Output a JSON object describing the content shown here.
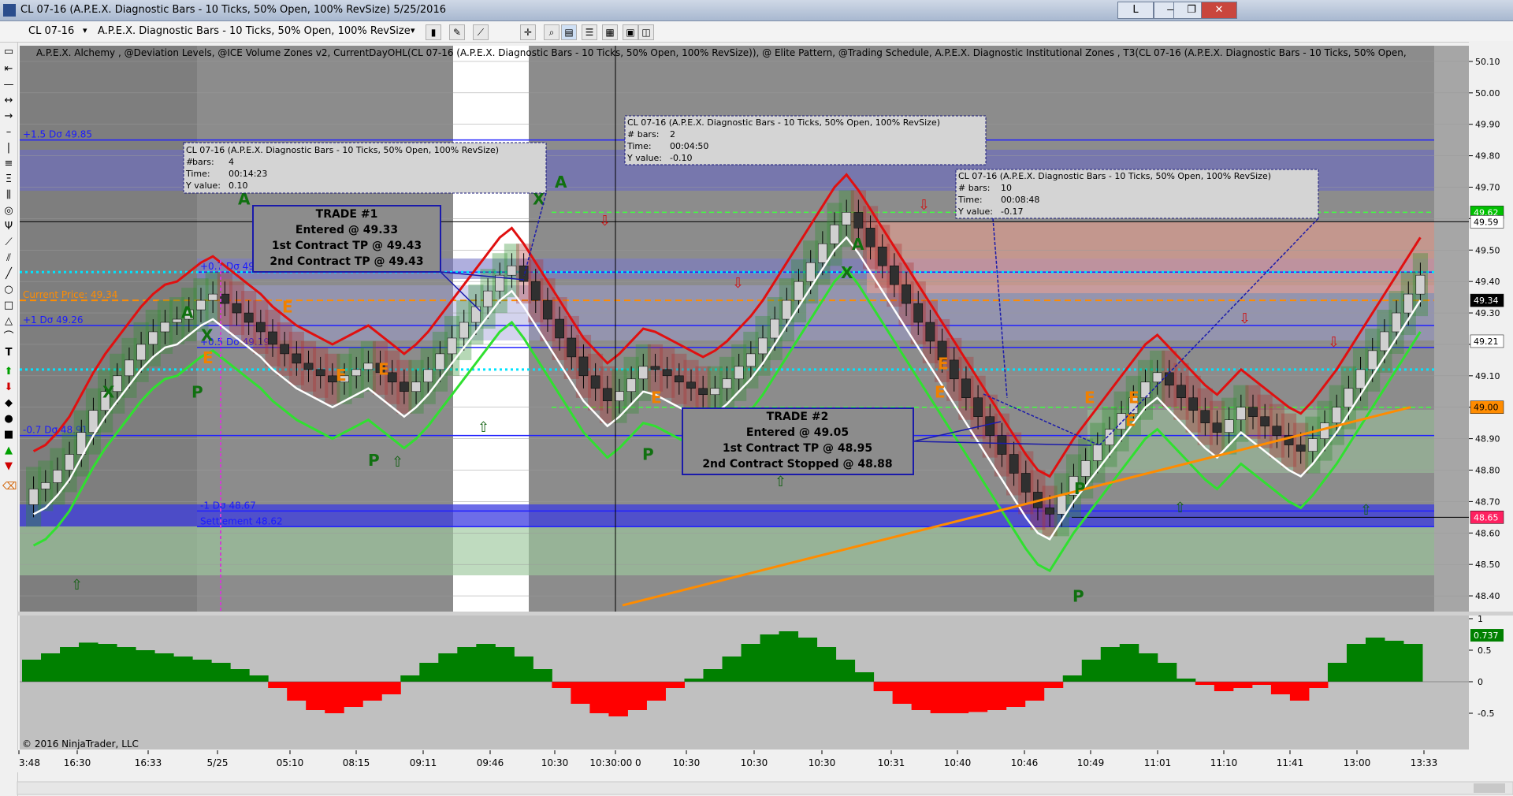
{
  "window": {
    "title": "CL 07-16 (A.P.E.X. Diagnostic Bars - 10 Ticks, 50% Open, 100% RevSize)  5/25/2016",
    "buttons": [
      "L",
      "—",
      "❐",
      "✕"
    ]
  },
  "toolbar": {
    "instrument": "CL 07-16",
    "bar_type": "A.P.E.X. Diagnostic Bars - 10 Ticks, 50% Open, 100% RevSize"
  },
  "indicator_label": "A.P.E.X. Alchemy , @Deviation Levels, @ICE Volume Zones v2, CurrentDayOHL(CL 07-16 (A.P.E.X. Diagnostic Bars - 10 Ticks, 50% Open, 100% RevSize)), @ Elite Pattern, @Trading Schedule, A.P.E.X. Diagnostic Institutional Zones , T3(CL 07-16 (A.P.E.X. Diagnostic Bars - 10 Ticks, 50% Open,",
  "copyright": "© 2016 NinjaTrader, LLC",
  "colors": {
    "up_bar": "#00c000",
    "down_bar": "#d00000",
    "pos_hist": "#008000",
    "neg_hist": "#ff0000",
    "price_line": "#ff8c00",
    "zone_blue": "#3a3aff",
    "cyan_level": "#00e5ff"
  },
  "chart_data": {
    "type": "candlestick",
    "instrument": "CL 07-16",
    "date": "5/25/2016",
    "ylim": [
      48.35,
      50.15
    ],
    "y_ticks": [
      "50.10",
      "50.00",
      "49.90",
      "49.80",
      "49.70",
      "49.60",
      "49.50",
      "49.40",
      "49.30",
      "49.20",
      "49.10",
      "49.00",
      "48.90",
      "48.80",
      "48.70",
      "48.60",
      "48.50",
      "48.40"
    ],
    "x_ticks": [
      "3:48",
      "16:30",
      "16:33",
      "5/25",
      "05:10",
      "08:15",
      "09:11",
      "09:46",
      "10:30",
      "10:30:00 0",
      "10:30",
      "10:30",
      "10:30",
      "10:31",
      "10:40",
      "10:46",
      "10:49",
      "11:01",
      "11:10",
      "11:41",
      "13:00",
      "13:33"
    ],
    "price_close": [
      48.74,
      48.76,
      48.8,
      48.85,
      48.92,
      48.99,
      49.05,
      49.1,
      49.15,
      49.2,
      49.24,
      49.27,
      49.28,
      49.31,
      49.34,
      49.36,
      49.33,
      49.3,
      49.27,
      49.24,
      49.2,
      49.17,
      49.14,
      49.12,
      49.1,
      49.08,
      49.1,
      49.12,
      49.14,
      49.11,
      49.08,
      49.05,
      49.08,
      49.12,
      49.17,
      49.22,
      49.27,
      49.32,
      49.37,
      49.42,
      49.45,
      49.4,
      49.34,
      49.28,
      49.22,
      49.16,
      49.1,
      49.06,
      49.02,
      49.05,
      49.09,
      49.13,
      49.12,
      49.1,
      49.08,
      49.06,
      49.04,
      49.06,
      49.09,
      49.13,
      49.17,
      49.22,
      49.28,
      49.34,
      49.4,
      49.46,
      49.52,
      49.58,
      49.62,
      49.57,
      49.51,
      49.45,
      49.39,
      49.33,
      49.27,
      49.21,
      49.15,
      49.09,
      49.03,
      48.97,
      48.91,
      48.85,
      48.79,
      48.73,
      48.68,
      48.66,
      48.72,
      48.78,
      48.83,
      48.88,
      48.93,
      48.98,
      49.03,
      49.08,
      49.11,
      49.07,
      49.03,
      48.99,
      48.95,
      48.92,
      48.96,
      49.0,
      48.97,
      48.94,
      48.91,
      48.88,
      48.86,
      48.9,
      48.95,
      49.0,
      49.06,
      49.12,
      49.18,
      49.24,
      49.3,
      49.36,
      49.42
    ],
    "horizontal_levels": [
      {
        "label": "+1.5 Dσ 49.85",
        "value": 49.85
      },
      {
        "label": "+0.7 Dσ 49.43",
        "value": 49.43
      },
      {
        "label": "Current Price: 49.34",
        "value": 49.34
      },
      {
        "label": "+1 Dσ 49.26",
        "value": 49.26
      },
      {
        "label": "+0.5 Dσ 49.19",
        "value": 49.19
      },
      {
        "label": "-0.7 Dσ 48.91",
        "value": 48.91
      },
      {
        "label": "-1 Dσ 48.67",
        "value": 48.67
      },
      {
        "label": "Settlement 48.62",
        "value": 48.62
      }
    ],
    "price_badges": [
      {
        "text": "49.62",
        "value": 49.62,
        "bg": "#00c000",
        "fg": "#ffffff"
      },
      {
        "text": "49.59",
        "value": 49.59,
        "bg": "#ffffff",
        "fg": "#000000"
      },
      {
        "text": "49.34",
        "value": 49.34,
        "bg": "#000000",
        "fg": "#ffffff"
      },
      {
        "text": "49.21",
        "value": 49.21,
        "bg": "#ffffff",
        "fg": "#000000"
      },
      {
        "text": "49.00",
        "value": 49.0,
        "bg": "#ff8c00",
        "fg": "#000000"
      },
      {
        "text": "48.65",
        "value": 48.65,
        "bg": "#ff2060",
        "fg": "#ffffff"
      }
    ],
    "tooltips": [
      {
        "title": "CL 07-16 (A.P.E.X. Diagnostic Bars - 10 Ticks, 50% Open, 100% RevSize)",
        "bars": "4",
        "time": "00:14:23",
        "yvalue": "0.10"
      },
      {
        "title": "CL 07-16 (A.P.E.X. Diagnostic Bars - 10 Ticks, 50% Open, 100% RevSize)",
        "bars": "2",
        "time": "00:04:50",
        "yvalue": "-0.10"
      },
      {
        "title": "CL 07-16 (A.P.E.X. Diagnostic Bars - 10 Ticks, 50% Open, 100% RevSize)",
        "bars": "10",
        "time": "00:08:48",
        "yvalue": "-0.17"
      }
    ],
    "trade_boxes": [
      {
        "lines": [
          "TRADE #1",
          "Entered @ 49.33",
          "1st Contract TP @ 49.43",
          "2nd Contract TP @ 49.43"
        ]
      },
      {
        "lines": [
          "TRADE #2",
          "Entered @ 49.05",
          "1st Contract TP @ 48.95",
          "2nd Contract Stopped @ 48.88"
        ]
      }
    ],
    "pattern_letters": [
      "X",
      "A",
      "X",
      "X",
      "A",
      "A",
      "P",
      "E",
      "E",
      "E",
      "E",
      "P",
      "E",
      "P",
      "X",
      "A",
      "P",
      "E",
      "E",
      "E",
      "E",
      "P",
      "E"
    ],
    "oscillator": {
      "ylim": [
        -1,
        1
      ],
      "y_ticks": [
        "1",
        "0.5",
        "0",
        "-0.5"
      ],
      "current_value": "0.737",
      "values": [
        0.35,
        0.45,
        0.55,
        0.62,
        0.6,
        0.55,
        0.5,
        0.45,
        0.4,
        0.35,
        0.3,
        0.2,
        0.1,
        -0.1,
        -0.3,
        -0.45,
        -0.5,
        -0.4,
        -0.3,
        -0.2,
        0.1,
        0.3,
        0.45,
        0.55,
        0.6,
        0.55,
        0.4,
        0.2,
        -0.1,
        -0.35,
        -0.5,
        -0.55,
        -0.45,
        -0.3,
        -0.1,
        0.05,
        0.2,
        0.4,
        0.6,
        0.75,
        0.8,
        0.7,
        0.55,
        0.35,
        0.15,
        -0.15,
        -0.35,
        -0.45,
        -0.5,
        -0.5,
        -0.48,
        -0.45,
        -0.4,
        -0.3,
        -0.1,
        0.1,
        0.35,
        0.55,
        0.6,
        0.45,
        0.3,
        0.05,
        -0.05,
        -0.15,
        -0.1,
        -0.05,
        -0.2,
        -0.3,
        -0.1,
        0.3,
        0.6,
        0.7,
        0.65,
        0.6
      ]
    }
  }
}
